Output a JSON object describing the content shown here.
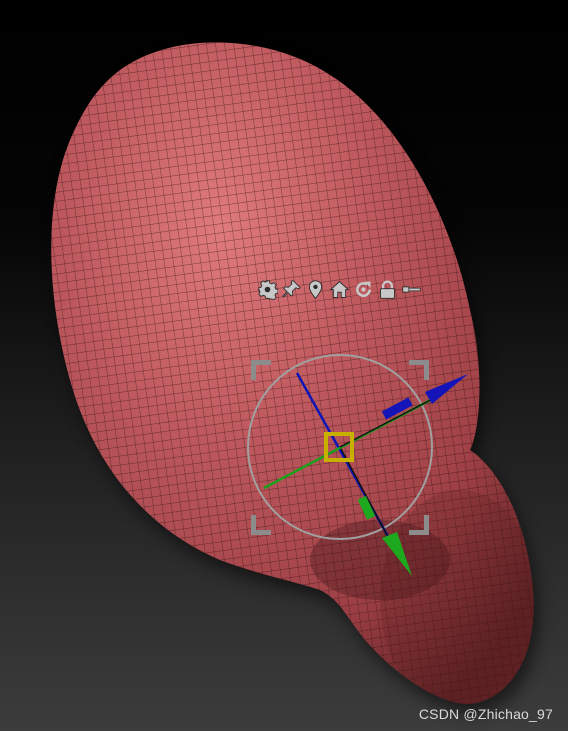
{
  "viewport": {
    "background_top": "#000000",
    "background_bottom": "#3c3c3c"
  },
  "mesh": {
    "name": "sculpt-mesh",
    "fill_color": "#b9555a",
    "highlight_color": "#e07a7c",
    "shadow_color": "#6a2628",
    "wire_color": "#2a0a0c"
  },
  "gizmo": {
    "ring_color": "#9a9a9a",
    "corner_color": "#8a8a8a",
    "x_axis_color": "#0a14b4",
    "y_axis_color": "#19a019",
    "z_axis_color": "#1a1ab0",
    "center_color": "#c8b400",
    "toolbar": [
      {
        "name": "gear-icon"
      },
      {
        "name": "pin-icon"
      },
      {
        "name": "location-icon"
      },
      {
        "name": "home-icon"
      },
      {
        "name": "reset-rotate-icon"
      },
      {
        "name": "lock-icon"
      },
      {
        "name": "key-icon"
      }
    ]
  },
  "watermark": {
    "text": "CSDN @Zhichao_97"
  }
}
